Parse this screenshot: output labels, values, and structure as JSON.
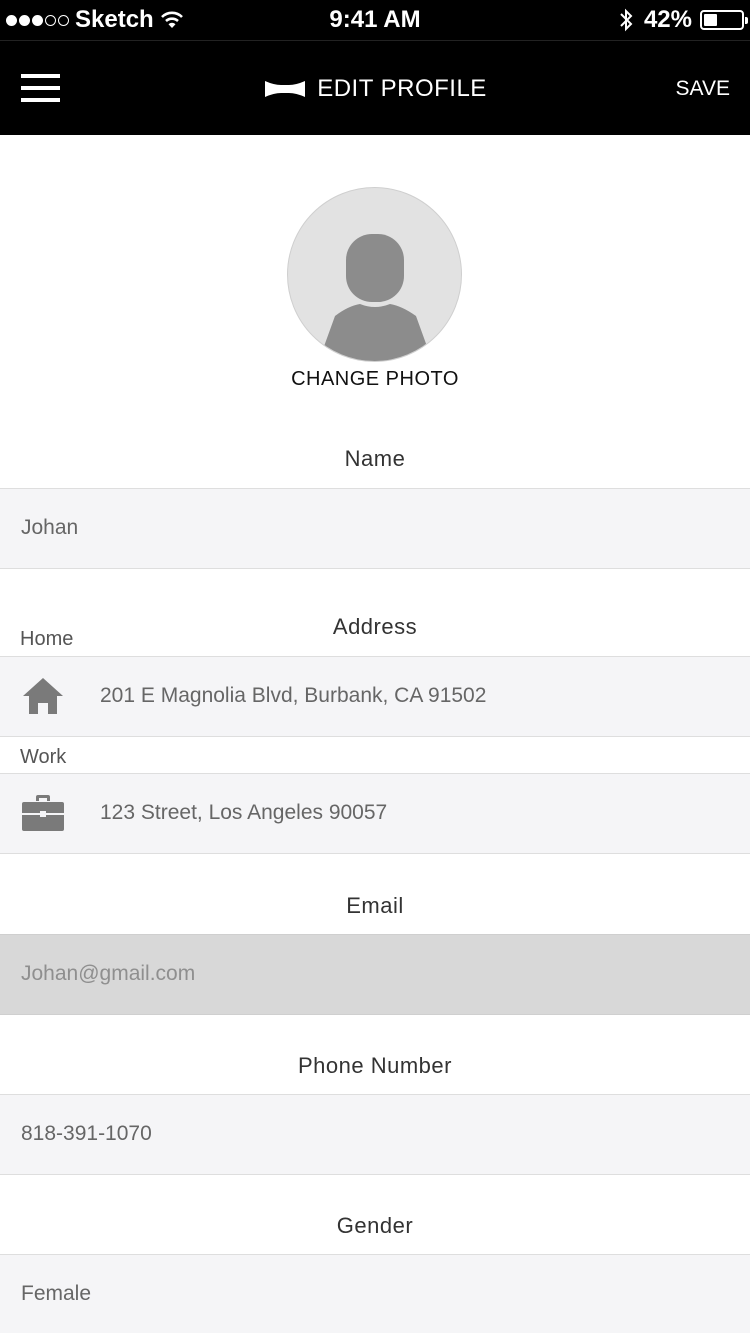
{
  "status_bar": {
    "carrier": "Sketch",
    "time": "9:41 AM",
    "battery_text": "42%",
    "battery_level": 0.42
  },
  "nav": {
    "title": "EDIT PROFILE",
    "save_label": "SAVE"
  },
  "profile": {
    "change_photo_label": "CHANGE PHOTO"
  },
  "sections": {
    "name": {
      "label": "Name",
      "value": "Johan"
    },
    "address": {
      "label": "Address",
      "home_label": "Home",
      "home_value": "201 E Magnolia Blvd, Burbank, CA 91502",
      "work_label": "Work",
      "work_value": "123 Street, Los Angeles 90057"
    },
    "email": {
      "label": "Email",
      "value": "Johan@gmail.com"
    },
    "phone": {
      "label": "Phone Number",
      "value": "818-391-1070"
    },
    "gender": {
      "label": "Gender",
      "value": "Female"
    }
  },
  "colors": {
    "header_bg": "#000000",
    "field_bg": "#f5f5f7",
    "disabled_field_bg": "#d8d8d8",
    "icon_gray": "#7a7a7a"
  }
}
